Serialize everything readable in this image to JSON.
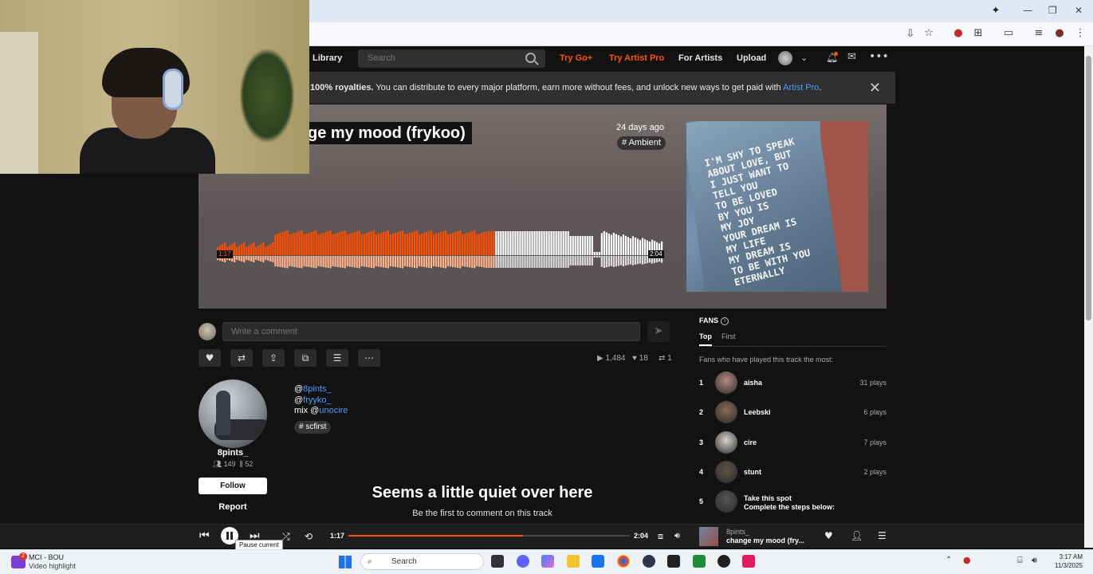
{
  "browser": {
    "window_controls": [
      "—",
      "❐",
      "✕"
    ]
  },
  "site_nav": {
    "library": "Library",
    "search_placeholder": "Search",
    "try_go": "Try Go+",
    "try_artist_pro": "Try Artist Pro",
    "for_artists": "For Artists",
    "upload": "Upload"
  },
  "banner": {
    "bold": "100% royalties.",
    "text": " You can distribute to every major platform, earn more without fees, and unlock new ways to get paid with ",
    "link": "Artist Pro",
    "end": "."
  },
  "track": {
    "title": "ge my mood (frykoo)",
    "posted": "24 days ago",
    "genre": "# Ambient",
    "elapsed": "1:17",
    "duration": "2:04",
    "progress_fraction": 0.621,
    "artwork_text": "I'M SHY TO SPEAK\nABOUT LOVE, BUT\nI JUST WANT TO\nTELL YOU\nTO BE LOVED\nBY YOU IS\nMY JOY\nYOUR DREAM IS\nMY LIFE\nMY DREAM IS\nTO BE WITH YOU\nETERNALLY"
  },
  "comment": {
    "placeholder": "Write a comment"
  },
  "stats": {
    "plays": "1,484",
    "likes": "18",
    "reposts": "1"
  },
  "artist": {
    "name": "8pints_",
    "followers": "149",
    "tracks": "52",
    "follow_label": "Follow",
    "report_label": "Report"
  },
  "description": {
    "line1_prefix": "@",
    "line1_link": "8pints_",
    "line2_prefix": "@",
    "line2_link": "fryyko_",
    "line3_prefix": "mix @",
    "line3_link": "unocire",
    "tag": "# scfirst"
  },
  "empty_comments": {
    "title": "Seems a little quiet over here",
    "subtitle": "Be the first to comment on this track"
  },
  "fans": {
    "title": "FANS",
    "tabs": [
      "Top",
      "First"
    ],
    "subtitle": "Fans who have played this track the most:",
    "rows": [
      {
        "rank": "1",
        "name": "aisha",
        "plays": "31 plays",
        "color": "#b58c80"
      },
      {
        "rank": "2",
        "name": "Leebski",
        "plays": "6 plays",
        "color": "#8a6a52"
      },
      {
        "rank": "3",
        "name": "cire",
        "plays": "7 plays",
        "color": "#d7d2cf"
      },
      {
        "rank": "4",
        "name": "stunt",
        "plays": "2 plays",
        "color": "#5d5448"
      },
      {
        "rank": "5",
        "name": "Take this spot",
        "plays": "",
        "color": "#555555",
        "sub": "Complete the steps below:"
      }
    ]
  },
  "player": {
    "tooltip": "Pause current",
    "elapsed": "1:17",
    "duration": "2:04",
    "artist": "8pints_",
    "title": "change my mood (fry..."
  },
  "taskbar": {
    "news_badge": "2",
    "news_line1": "MCI - BOU",
    "news_line2": "Video highlight",
    "search": "Search",
    "time": "3:17 AM",
    "date": "11/3/2025"
  },
  "colors": {
    "accent": "#ff5500",
    "link": "#4a9eff",
    "background": "#121212"
  }
}
